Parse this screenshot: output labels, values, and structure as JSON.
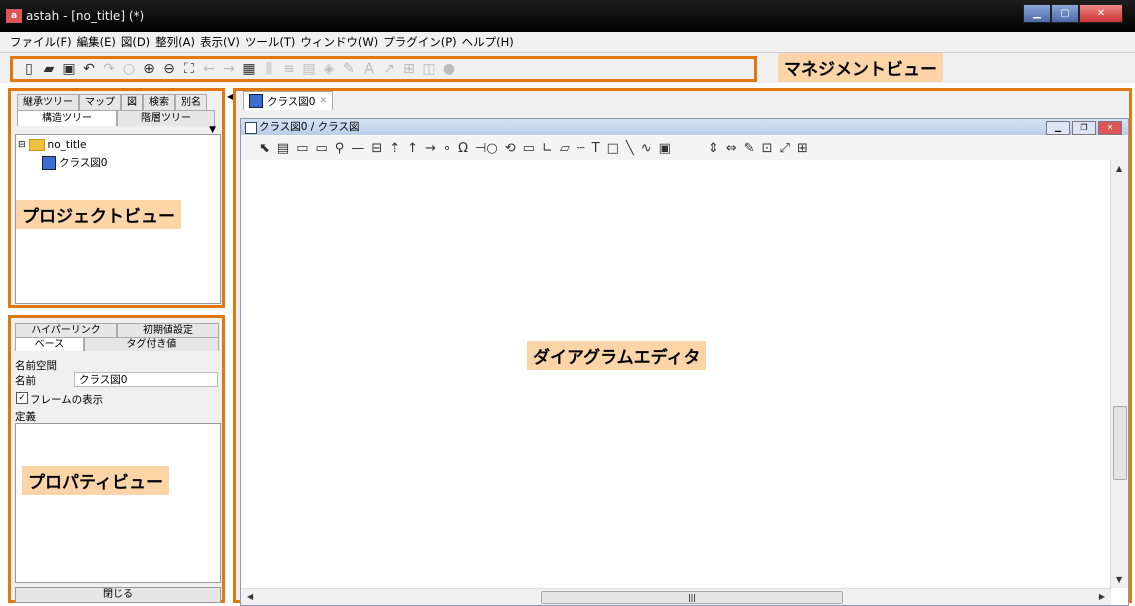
{
  "window": {
    "app_icon": "astah-logo",
    "title": "astah - [no_title] (*)"
  },
  "menu": [
    "ファイル(F)",
    "編集(E)",
    "図(D)",
    "整列(A)",
    "表示(V)",
    "ツール(T)",
    "ウィンドウ(W)",
    "プラグイン(P)",
    "ヘルプ(H)"
  ],
  "annotations": {
    "management": "マネジメントビュー",
    "project": "プロジェクトビュー",
    "property": "プロパティビュー",
    "diagram": "ダイアグラムエディタ"
  },
  "project_tabs": {
    "row1": [
      "継承ツリー",
      "マップ",
      "図",
      "検索",
      "別名"
    ],
    "row2": [
      "構造ツリー",
      "階層ツリー"
    ]
  },
  "tree": {
    "root": "no_title",
    "child": "クラス図0"
  },
  "property_tabs": {
    "row1": [
      "ハイパーリンク",
      "初期値設定"
    ],
    "row2": [
      "ベース",
      "タグ付き値"
    ]
  },
  "properties": {
    "namespace_label": "名前空間",
    "name_label": "名前",
    "name_value": "クラス図0",
    "frame_label": "フレームの表示",
    "frame_checked": true,
    "definition_label": "定義",
    "close_label": "閉じる"
  },
  "editor": {
    "tab_label": "クラス図0",
    "window_title": "クラス図0 / クラス図"
  },
  "colors": {
    "highlight_border": "#e07a10",
    "label_background": "#fbd4a8"
  }
}
